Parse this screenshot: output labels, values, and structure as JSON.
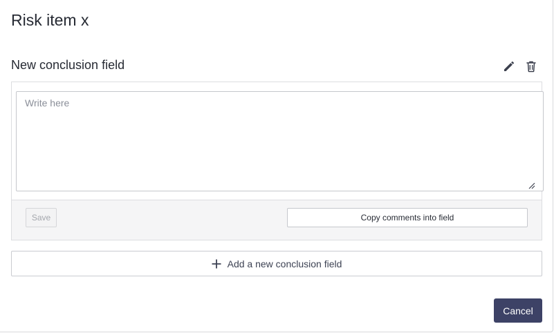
{
  "dialog": {
    "title": "Risk item x"
  },
  "conclusion_field": {
    "title": "New conclusion field",
    "edit_icon": "pencil-icon",
    "delete_icon": "trash-icon",
    "textarea": {
      "value": "",
      "placeholder": "Write here"
    },
    "save_label": "Save",
    "copy_label": "Copy comments into field"
  },
  "add_field": {
    "icon": "plus-icon",
    "label": "Add a new conclusion field"
  },
  "footer": {
    "cancel_label": "Cancel"
  },
  "colors": {
    "primary_button": "#3d4266",
    "text": "#262a33",
    "border": "#c5c7cc",
    "panel_bg": "#f5f5f6"
  }
}
